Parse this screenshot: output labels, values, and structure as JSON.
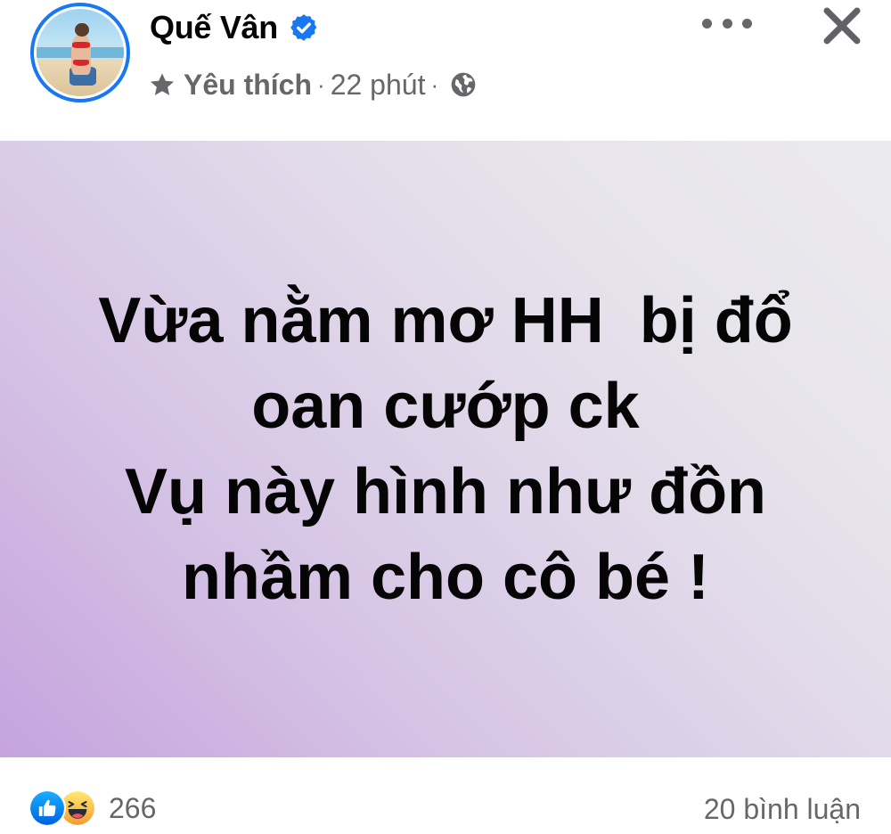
{
  "author": {
    "name": "Quế Vân",
    "verified_icon": "verified-badge-icon",
    "avatar_alt": "profile photo"
  },
  "meta": {
    "favorite_label": "Yêu thích",
    "separator": "·",
    "time": "22 phút",
    "audience_icon": "globe-icon"
  },
  "post": {
    "lines": [
      "Vừa nằm mơ HH  bị đổ",
      "oan cướp ck",
      "Vụ này hình như đồn",
      "nhầm cho cô bé !"
    ],
    "background": [
      "#c6a3de",
      "#ebeaee"
    ]
  },
  "reactions": {
    "icons": [
      "like-icon",
      "haha-icon"
    ],
    "count": "266"
  },
  "comments": {
    "label": "20 bình luận"
  },
  "colors": {
    "accent": "#1877f2",
    "text": "#050505",
    "secondary": "#65676b"
  }
}
